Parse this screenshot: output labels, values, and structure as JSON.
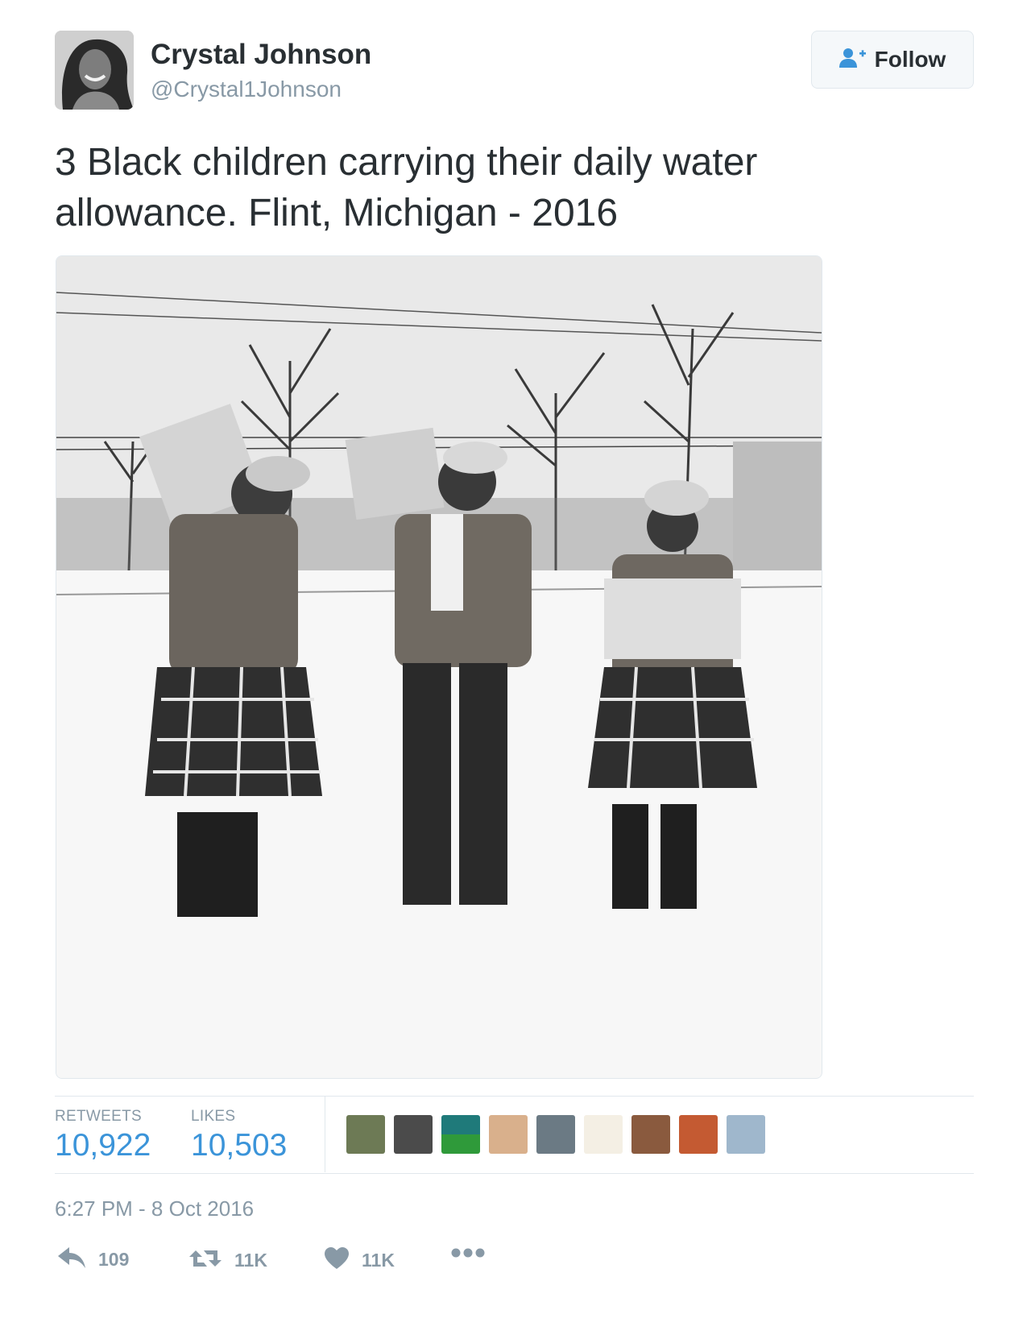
{
  "user": {
    "display_name": "Crystal Johnson",
    "handle": "@Crystal1Johnson",
    "avatar_icon": "profile-photo"
  },
  "follow_button": {
    "label": "Follow",
    "icon": "add-user-icon"
  },
  "tweet": {
    "text": "3 Black children carrying their daily water allowance. Flint, Michigan - 2016",
    "photo": "three-children-carrying-water-cases-in-snow"
  },
  "stats": {
    "retweets_label": "RETWEETS",
    "retweets_value": "10,922",
    "likes_label": "LIKES",
    "likes_value": "10,503"
  },
  "likers": [
    "liker-1",
    "liker-2",
    "liker-3",
    "liker-4",
    "liker-5",
    "liker-6",
    "liker-7",
    "liker-8",
    "liker-9"
  ],
  "timestamp": "6:27 PM - 8 Oct 2016",
  "actions": {
    "reply_count": "109",
    "retweet_count": "11K",
    "like_count": "11K"
  },
  "colors": {
    "link_blue": "#3b94d9",
    "muted_gray": "#8899a6",
    "text_dark": "#292f33",
    "border": "#e1e8ed"
  }
}
